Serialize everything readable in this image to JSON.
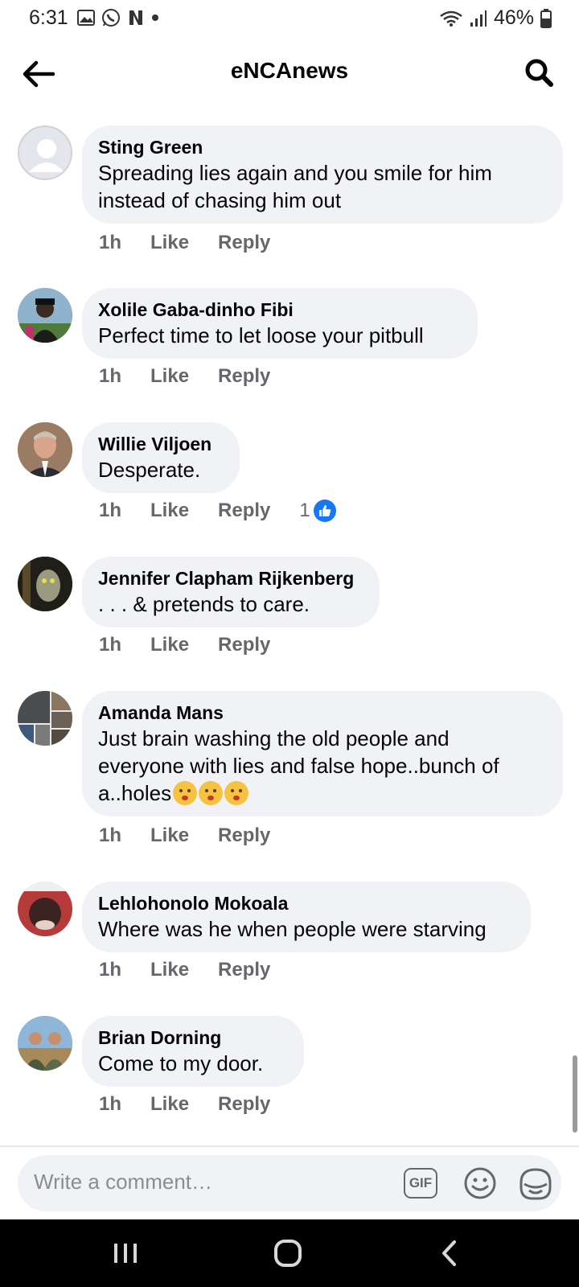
{
  "status_bar": {
    "time": "6:31",
    "battery": "46%"
  },
  "header": {
    "title": "eNCAnews"
  },
  "comments": [
    {
      "author": "Sting Green",
      "lines": [
        "Spreading lies again and you smile for him",
        "instead of chasing him out"
      ],
      "time": "1h",
      "like": "Like",
      "reply": "Reply"
    },
    {
      "author": "Xolile Gaba-dinho Fibi",
      "lines": [
        "Perfect time to let loose your pitbull"
      ],
      "time": "1h",
      "like": "Like",
      "reply": "Reply"
    },
    {
      "author": "Willie Viljoen",
      "lines": [
        "Desperate."
      ],
      "time": "1h",
      "like": "Like",
      "reply": "Reply",
      "reaction_count": "1"
    },
    {
      "author": "Jennifer Clapham Rijkenberg",
      "lines": [
        ". . . & pretends to care."
      ],
      "time": "1h",
      "like": "Like",
      "reply": "Reply"
    },
    {
      "author": "Amanda Mans",
      "lines": [
        "Just brain washing the old people and",
        "everyone with lies and false hope..bunch of",
        "a..holes"
      ],
      "time": "1h",
      "like": "Like",
      "reply": "Reply"
    },
    {
      "author": "Lehlohonolo Mokoala",
      "lines": [
        "Where was he when people were starving"
      ],
      "time": "1h",
      "like": "Like",
      "reply": "Reply"
    },
    {
      "author": "Brian Dorning",
      "lines": [
        "Come to my door."
      ],
      "time": "1h",
      "like": "Like",
      "reply": "Reply"
    }
  ],
  "composer": {
    "placeholder": "Write a comment…",
    "gif_label": "GIF"
  },
  "colors": {
    "bubble": "#f0f2f5",
    "meta_text": "#65676b",
    "like_blue": "#1877f2"
  }
}
